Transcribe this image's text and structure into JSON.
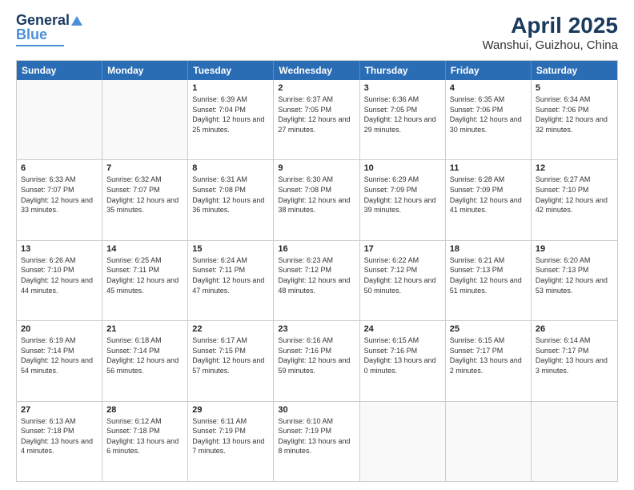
{
  "logo": {
    "line1": "General",
    "line2": "Blue"
  },
  "title": "April 2025",
  "subtitle": "Wanshui, Guizhou, China",
  "header_days": [
    "Sunday",
    "Monday",
    "Tuesday",
    "Wednesday",
    "Thursday",
    "Friday",
    "Saturday"
  ],
  "weeks": [
    [
      {
        "day": "",
        "sunrise": "",
        "sunset": "",
        "daylight": ""
      },
      {
        "day": "",
        "sunrise": "",
        "sunset": "",
        "daylight": ""
      },
      {
        "day": "1",
        "sunrise": "Sunrise: 6:39 AM",
        "sunset": "Sunset: 7:04 PM",
        "daylight": "Daylight: 12 hours and 25 minutes."
      },
      {
        "day": "2",
        "sunrise": "Sunrise: 6:37 AM",
        "sunset": "Sunset: 7:05 PM",
        "daylight": "Daylight: 12 hours and 27 minutes."
      },
      {
        "day": "3",
        "sunrise": "Sunrise: 6:36 AM",
        "sunset": "Sunset: 7:05 PM",
        "daylight": "Daylight: 12 hours and 29 minutes."
      },
      {
        "day": "4",
        "sunrise": "Sunrise: 6:35 AM",
        "sunset": "Sunset: 7:06 PM",
        "daylight": "Daylight: 12 hours and 30 minutes."
      },
      {
        "day": "5",
        "sunrise": "Sunrise: 6:34 AM",
        "sunset": "Sunset: 7:06 PM",
        "daylight": "Daylight: 12 hours and 32 minutes."
      }
    ],
    [
      {
        "day": "6",
        "sunrise": "Sunrise: 6:33 AM",
        "sunset": "Sunset: 7:07 PM",
        "daylight": "Daylight: 12 hours and 33 minutes."
      },
      {
        "day": "7",
        "sunrise": "Sunrise: 6:32 AM",
        "sunset": "Sunset: 7:07 PM",
        "daylight": "Daylight: 12 hours and 35 minutes."
      },
      {
        "day": "8",
        "sunrise": "Sunrise: 6:31 AM",
        "sunset": "Sunset: 7:08 PM",
        "daylight": "Daylight: 12 hours and 36 minutes."
      },
      {
        "day": "9",
        "sunrise": "Sunrise: 6:30 AM",
        "sunset": "Sunset: 7:08 PM",
        "daylight": "Daylight: 12 hours and 38 minutes."
      },
      {
        "day": "10",
        "sunrise": "Sunrise: 6:29 AM",
        "sunset": "Sunset: 7:09 PM",
        "daylight": "Daylight: 12 hours and 39 minutes."
      },
      {
        "day": "11",
        "sunrise": "Sunrise: 6:28 AM",
        "sunset": "Sunset: 7:09 PM",
        "daylight": "Daylight: 12 hours and 41 minutes."
      },
      {
        "day": "12",
        "sunrise": "Sunrise: 6:27 AM",
        "sunset": "Sunset: 7:10 PM",
        "daylight": "Daylight: 12 hours and 42 minutes."
      }
    ],
    [
      {
        "day": "13",
        "sunrise": "Sunrise: 6:26 AM",
        "sunset": "Sunset: 7:10 PM",
        "daylight": "Daylight: 12 hours and 44 minutes."
      },
      {
        "day": "14",
        "sunrise": "Sunrise: 6:25 AM",
        "sunset": "Sunset: 7:11 PM",
        "daylight": "Daylight: 12 hours and 45 minutes."
      },
      {
        "day": "15",
        "sunrise": "Sunrise: 6:24 AM",
        "sunset": "Sunset: 7:11 PM",
        "daylight": "Daylight: 12 hours and 47 minutes."
      },
      {
        "day": "16",
        "sunrise": "Sunrise: 6:23 AM",
        "sunset": "Sunset: 7:12 PM",
        "daylight": "Daylight: 12 hours and 48 minutes."
      },
      {
        "day": "17",
        "sunrise": "Sunrise: 6:22 AM",
        "sunset": "Sunset: 7:12 PM",
        "daylight": "Daylight: 12 hours and 50 minutes."
      },
      {
        "day": "18",
        "sunrise": "Sunrise: 6:21 AM",
        "sunset": "Sunset: 7:13 PM",
        "daylight": "Daylight: 12 hours and 51 minutes."
      },
      {
        "day": "19",
        "sunrise": "Sunrise: 6:20 AM",
        "sunset": "Sunset: 7:13 PM",
        "daylight": "Daylight: 12 hours and 53 minutes."
      }
    ],
    [
      {
        "day": "20",
        "sunrise": "Sunrise: 6:19 AM",
        "sunset": "Sunset: 7:14 PM",
        "daylight": "Daylight: 12 hours and 54 minutes."
      },
      {
        "day": "21",
        "sunrise": "Sunrise: 6:18 AM",
        "sunset": "Sunset: 7:14 PM",
        "daylight": "Daylight: 12 hours and 56 minutes."
      },
      {
        "day": "22",
        "sunrise": "Sunrise: 6:17 AM",
        "sunset": "Sunset: 7:15 PM",
        "daylight": "Daylight: 12 hours and 57 minutes."
      },
      {
        "day": "23",
        "sunrise": "Sunrise: 6:16 AM",
        "sunset": "Sunset: 7:16 PM",
        "daylight": "Daylight: 12 hours and 59 minutes."
      },
      {
        "day": "24",
        "sunrise": "Sunrise: 6:15 AM",
        "sunset": "Sunset: 7:16 PM",
        "daylight": "Daylight: 13 hours and 0 minutes."
      },
      {
        "day": "25",
        "sunrise": "Sunrise: 6:15 AM",
        "sunset": "Sunset: 7:17 PM",
        "daylight": "Daylight: 13 hours and 2 minutes."
      },
      {
        "day": "26",
        "sunrise": "Sunrise: 6:14 AM",
        "sunset": "Sunset: 7:17 PM",
        "daylight": "Daylight: 13 hours and 3 minutes."
      }
    ],
    [
      {
        "day": "27",
        "sunrise": "Sunrise: 6:13 AM",
        "sunset": "Sunset: 7:18 PM",
        "daylight": "Daylight: 13 hours and 4 minutes."
      },
      {
        "day": "28",
        "sunrise": "Sunrise: 6:12 AM",
        "sunset": "Sunset: 7:18 PM",
        "daylight": "Daylight: 13 hours and 6 minutes."
      },
      {
        "day": "29",
        "sunrise": "Sunrise: 6:11 AM",
        "sunset": "Sunset: 7:19 PM",
        "daylight": "Daylight: 13 hours and 7 minutes."
      },
      {
        "day": "30",
        "sunrise": "Sunrise: 6:10 AM",
        "sunset": "Sunset: 7:19 PM",
        "daylight": "Daylight: 13 hours and 8 minutes."
      },
      {
        "day": "",
        "sunrise": "",
        "sunset": "",
        "daylight": ""
      },
      {
        "day": "",
        "sunrise": "",
        "sunset": "",
        "daylight": ""
      },
      {
        "day": "",
        "sunrise": "",
        "sunset": "",
        "daylight": ""
      }
    ]
  ]
}
